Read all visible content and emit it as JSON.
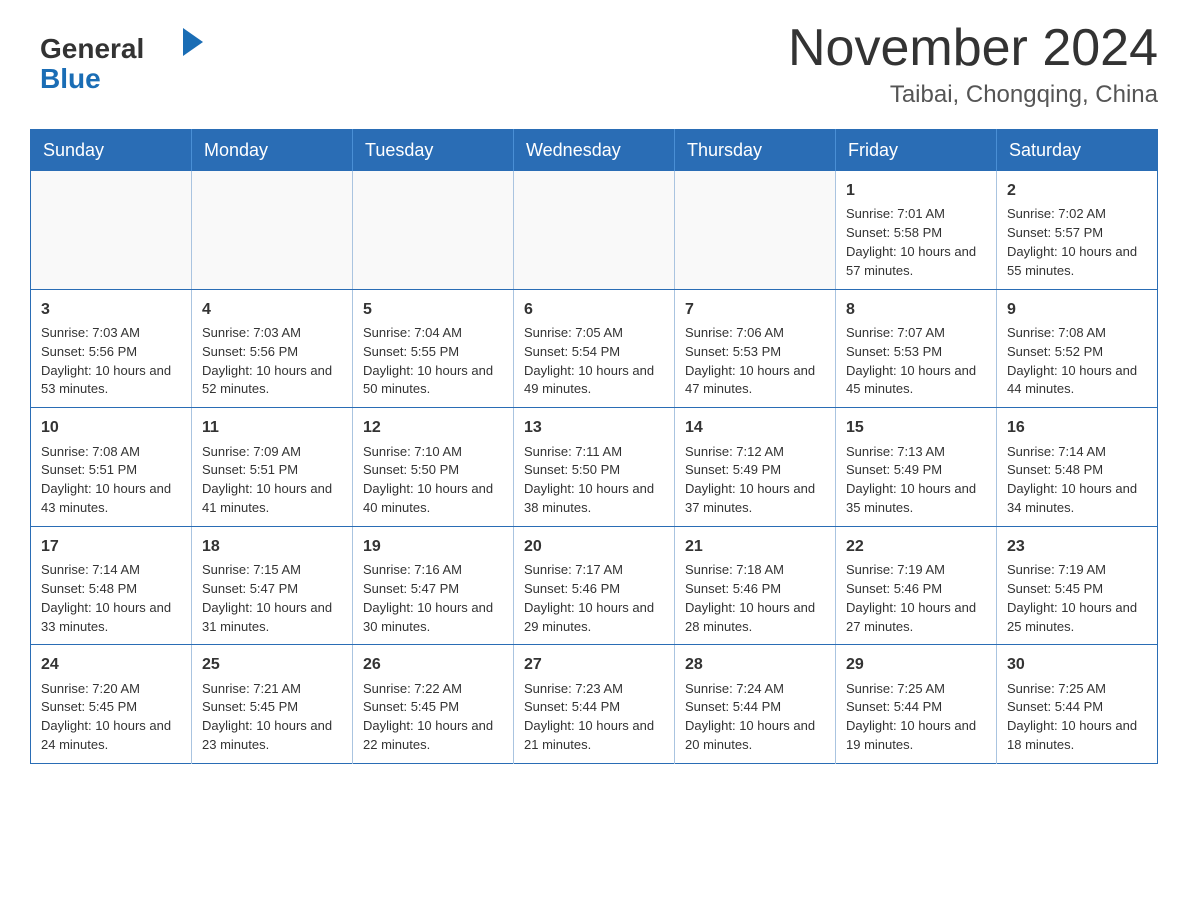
{
  "header": {
    "logo_general": "General",
    "logo_blue": "Blue",
    "month_title": "November 2024",
    "location": "Taibai, Chongqing, China"
  },
  "weekdays": [
    "Sunday",
    "Monday",
    "Tuesday",
    "Wednesday",
    "Thursday",
    "Friday",
    "Saturday"
  ],
  "weeks": [
    [
      {
        "day": "",
        "sunrise": "",
        "sunset": "",
        "daylight": ""
      },
      {
        "day": "",
        "sunrise": "",
        "sunset": "",
        "daylight": ""
      },
      {
        "day": "",
        "sunrise": "",
        "sunset": "",
        "daylight": ""
      },
      {
        "day": "",
        "sunrise": "",
        "sunset": "",
        "daylight": ""
      },
      {
        "day": "",
        "sunrise": "",
        "sunset": "",
        "daylight": ""
      },
      {
        "day": "1",
        "sunrise": "Sunrise: 7:01 AM",
        "sunset": "Sunset: 5:58 PM",
        "daylight": "Daylight: 10 hours and 57 minutes."
      },
      {
        "day": "2",
        "sunrise": "Sunrise: 7:02 AM",
        "sunset": "Sunset: 5:57 PM",
        "daylight": "Daylight: 10 hours and 55 minutes."
      }
    ],
    [
      {
        "day": "3",
        "sunrise": "Sunrise: 7:03 AM",
        "sunset": "Sunset: 5:56 PM",
        "daylight": "Daylight: 10 hours and 53 minutes."
      },
      {
        "day": "4",
        "sunrise": "Sunrise: 7:03 AM",
        "sunset": "Sunset: 5:56 PM",
        "daylight": "Daylight: 10 hours and 52 minutes."
      },
      {
        "day": "5",
        "sunrise": "Sunrise: 7:04 AM",
        "sunset": "Sunset: 5:55 PM",
        "daylight": "Daylight: 10 hours and 50 minutes."
      },
      {
        "day": "6",
        "sunrise": "Sunrise: 7:05 AM",
        "sunset": "Sunset: 5:54 PM",
        "daylight": "Daylight: 10 hours and 49 minutes."
      },
      {
        "day": "7",
        "sunrise": "Sunrise: 7:06 AM",
        "sunset": "Sunset: 5:53 PM",
        "daylight": "Daylight: 10 hours and 47 minutes."
      },
      {
        "day": "8",
        "sunrise": "Sunrise: 7:07 AM",
        "sunset": "Sunset: 5:53 PM",
        "daylight": "Daylight: 10 hours and 45 minutes."
      },
      {
        "day": "9",
        "sunrise": "Sunrise: 7:08 AM",
        "sunset": "Sunset: 5:52 PM",
        "daylight": "Daylight: 10 hours and 44 minutes."
      }
    ],
    [
      {
        "day": "10",
        "sunrise": "Sunrise: 7:08 AM",
        "sunset": "Sunset: 5:51 PM",
        "daylight": "Daylight: 10 hours and 43 minutes."
      },
      {
        "day": "11",
        "sunrise": "Sunrise: 7:09 AM",
        "sunset": "Sunset: 5:51 PM",
        "daylight": "Daylight: 10 hours and 41 minutes."
      },
      {
        "day": "12",
        "sunrise": "Sunrise: 7:10 AM",
        "sunset": "Sunset: 5:50 PM",
        "daylight": "Daylight: 10 hours and 40 minutes."
      },
      {
        "day": "13",
        "sunrise": "Sunrise: 7:11 AM",
        "sunset": "Sunset: 5:50 PM",
        "daylight": "Daylight: 10 hours and 38 minutes."
      },
      {
        "day": "14",
        "sunrise": "Sunrise: 7:12 AM",
        "sunset": "Sunset: 5:49 PM",
        "daylight": "Daylight: 10 hours and 37 minutes."
      },
      {
        "day": "15",
        "sunrise": "Sunrise: 7:13 AM",
        "sunset": "Sunset: 5:49 PM",
        "daylight": "Daylight: 10 hours and 35 minutes."
      },
      {
        "day": "16",
        "sunrise": "Sunrise: 7:14 AM",
        "sunset": "Sunset: 5:48 PM",
        "daylight": "Daylight: 10 hours and 34 minutes."
      }
    ],
    [
      {
        "day": "17",
        "sunrise": "Sunrise: 7:14 AM",
        "sunset": "Sunset: 5:48 PM",
        "daylight": "Daylight: 10 hours and 33 minutes."
      },
      {
        "day": "18",
        "sunrise": "Sunrise: 7:15 AM",
        "sunset": "Sunset: 5:47 PM",
        "daylight": "Daylight: 10 hours and 31 minutes."
      },
      {
        "day": "19",
        "sunrise": "Sunrise: 7:16 AM",
        "sunset": "Sunset: 5:47 PM",
        "daylight": "Daylight: 10 hours and 30 minutes."
      },
      {
        "day": "20",
        "sunrise": "Sunrise: 7:17 AM",
        "sunset": "Sunset: 5:46 PM",
        "daylight": "Daylight: 10 hours and 29 minutes."
      },
      {
        "day": "21",
        "sunrise": "Sunrise: 7:18 AM",
        "sunset": "Sunset: 5:46 PM",
        "daylight": "Daylight: 10 hours and 28 minutes."
      },
      {
        "day": "22",
        "sunrise": "Sunrise: 7:19 AM",
        "sunset": "Sunset: 5:46 PM",
        "daylight": "Daylight: 10 hours and 27 minutes."
      },
      {
        "day": "23",
        "sunrise": "Sunrise: 7:19 AM",
        "sunset": "Sunset: 5:45 PM",
        "daylight": "Daylight: 10 hours and 25 minutes."
      }
    ],
    [
      {
        "day": "24",
        "sunrise": "Sunrise: 7:20 AM",
        "sunset": "Sunset: 5:45 PM",
        "daylight": "Daylight: 10 hours and 24 minutes."
      },
      {
        "day": "25",
        "sunrise": "Sunrise: 7:21 AM",
        "sunset": "Sunset: 5:45 PM",
        "daylight": "Daylight: 10 hours and 23 minutes."
      },
      {
        "day": "26",
        "sunrise": "Sunrise: 7:22 AM",
        "sunset": "Sunset: 5:45 PM",
        "daylight": "Daylight: 10 hours and 22 minutes."
      },
      {
        "day": "27",
        "sunrise": "Sunrise: 7:23 AM",
        "sunset": "Sunset: 5:44 PM",
        "daylight": "Daylight: 10 hours and 21 minutes."
      },
      {
        "day": "28",
        "sunrise": "Sunrise: 7:24 AM",
        "sunset": "Sunset: 5:44 PM",
        "daylight": "Daylight: 10 hours and 20 minutes."
      },
      {
        "day": "29",
        "sunrise": "Sunrise: 7:25 AM",
        "sunset": "Sunset: 5:44 PM",
        "daylight": "Daylight: 10 hours and 19 minutes."
      },
      {
        "day": "30",
        "sunrise": "Sunrise: 7:25 AM",
        "sunset": "Sunset: 5:44 PM",
        "daylight": "Daylight: 10 hours and 18 minutes."
      }
    ]
  ]
}
